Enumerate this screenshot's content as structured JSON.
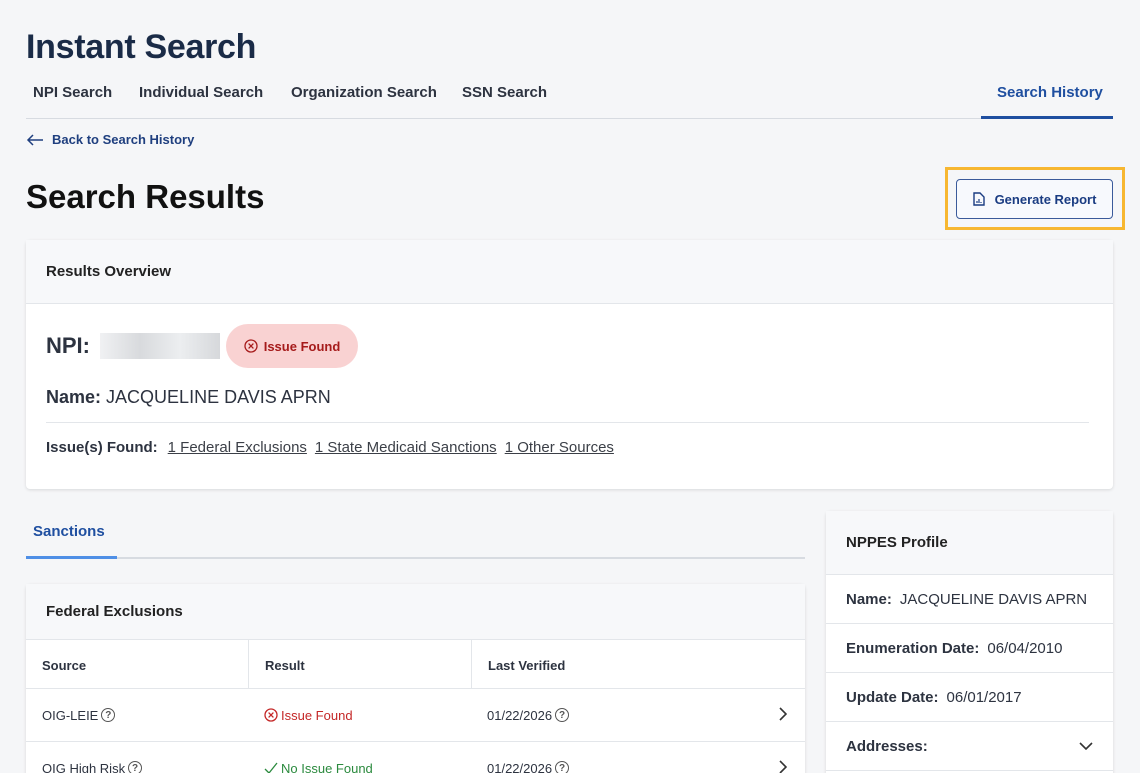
{
  "header": {
    "title": "Instant Search",
    "tabs": [
      {
        "label": "NPI Search"
      },
      {
        "label": "Individual Search"
      },
      {
        "label": "Organization Search"
      },
      {
        "label": "SSN Search"
      },
      {
        "label": "Search History"
      }
    ],
    "active_tab": "Search History"
  },
  "back_link": "Back to Search History",
  "page": {
    "title": "Search Results",
    "generate_report": "Generate Report",
    "highlight_color": "#f7b731"
  },
  "overview": {
    "heading": "Results Overview",
    "npi_label": "NPI:",
    "badge": "Issue Found",
    "name_label": "Name:",
    "name_value": "JACQUELINE DAVIS APRN",
    "issues_label": "Issue(s) Found:",
    "issues": [
      "1 Federal Exclusions",
      "1 State Medicaid Sanctions",
      "1 Other Sources"
    ]
  },
  "sanctions": {
    "tab": "Sanctions",
    "federal": {
      "heading": "Federal Exclusions",
      "columns": [
        "Source",
        "Result",
        "Last Verified"
      ],
      "rows": [
        {
          "source": "OIG-LEIE",
          "result": "Issue Found",
          "status": "issue",
          "verified": "01/22/2026"
        },
        {
          "source": "OIG High Risk",
          "result": "No Issue Found",
          "status": "ok",
          "verified": "01/22/2026"
        }
      ]
    }
  },
  "nppes": {
    "heading": "NPPES Profile",
    "name_label": "Name:",
    "name_value": "JACQUELINE DAVIS APRN",
    "enum_label": "Enumeration Date:",
    "enum_value": "06/04/2010",
    "update_label": "Update Date:",
    "update_value": "06/01/2017",
    "addresses_label": "Addresses:"
  },
  "colors": {
    "accent": "#1f4fa0",
    "issue": "#c42727",
    "ok": "#2b8a3e",
    "badge_bg": "#f9d2d2"
  }
}
